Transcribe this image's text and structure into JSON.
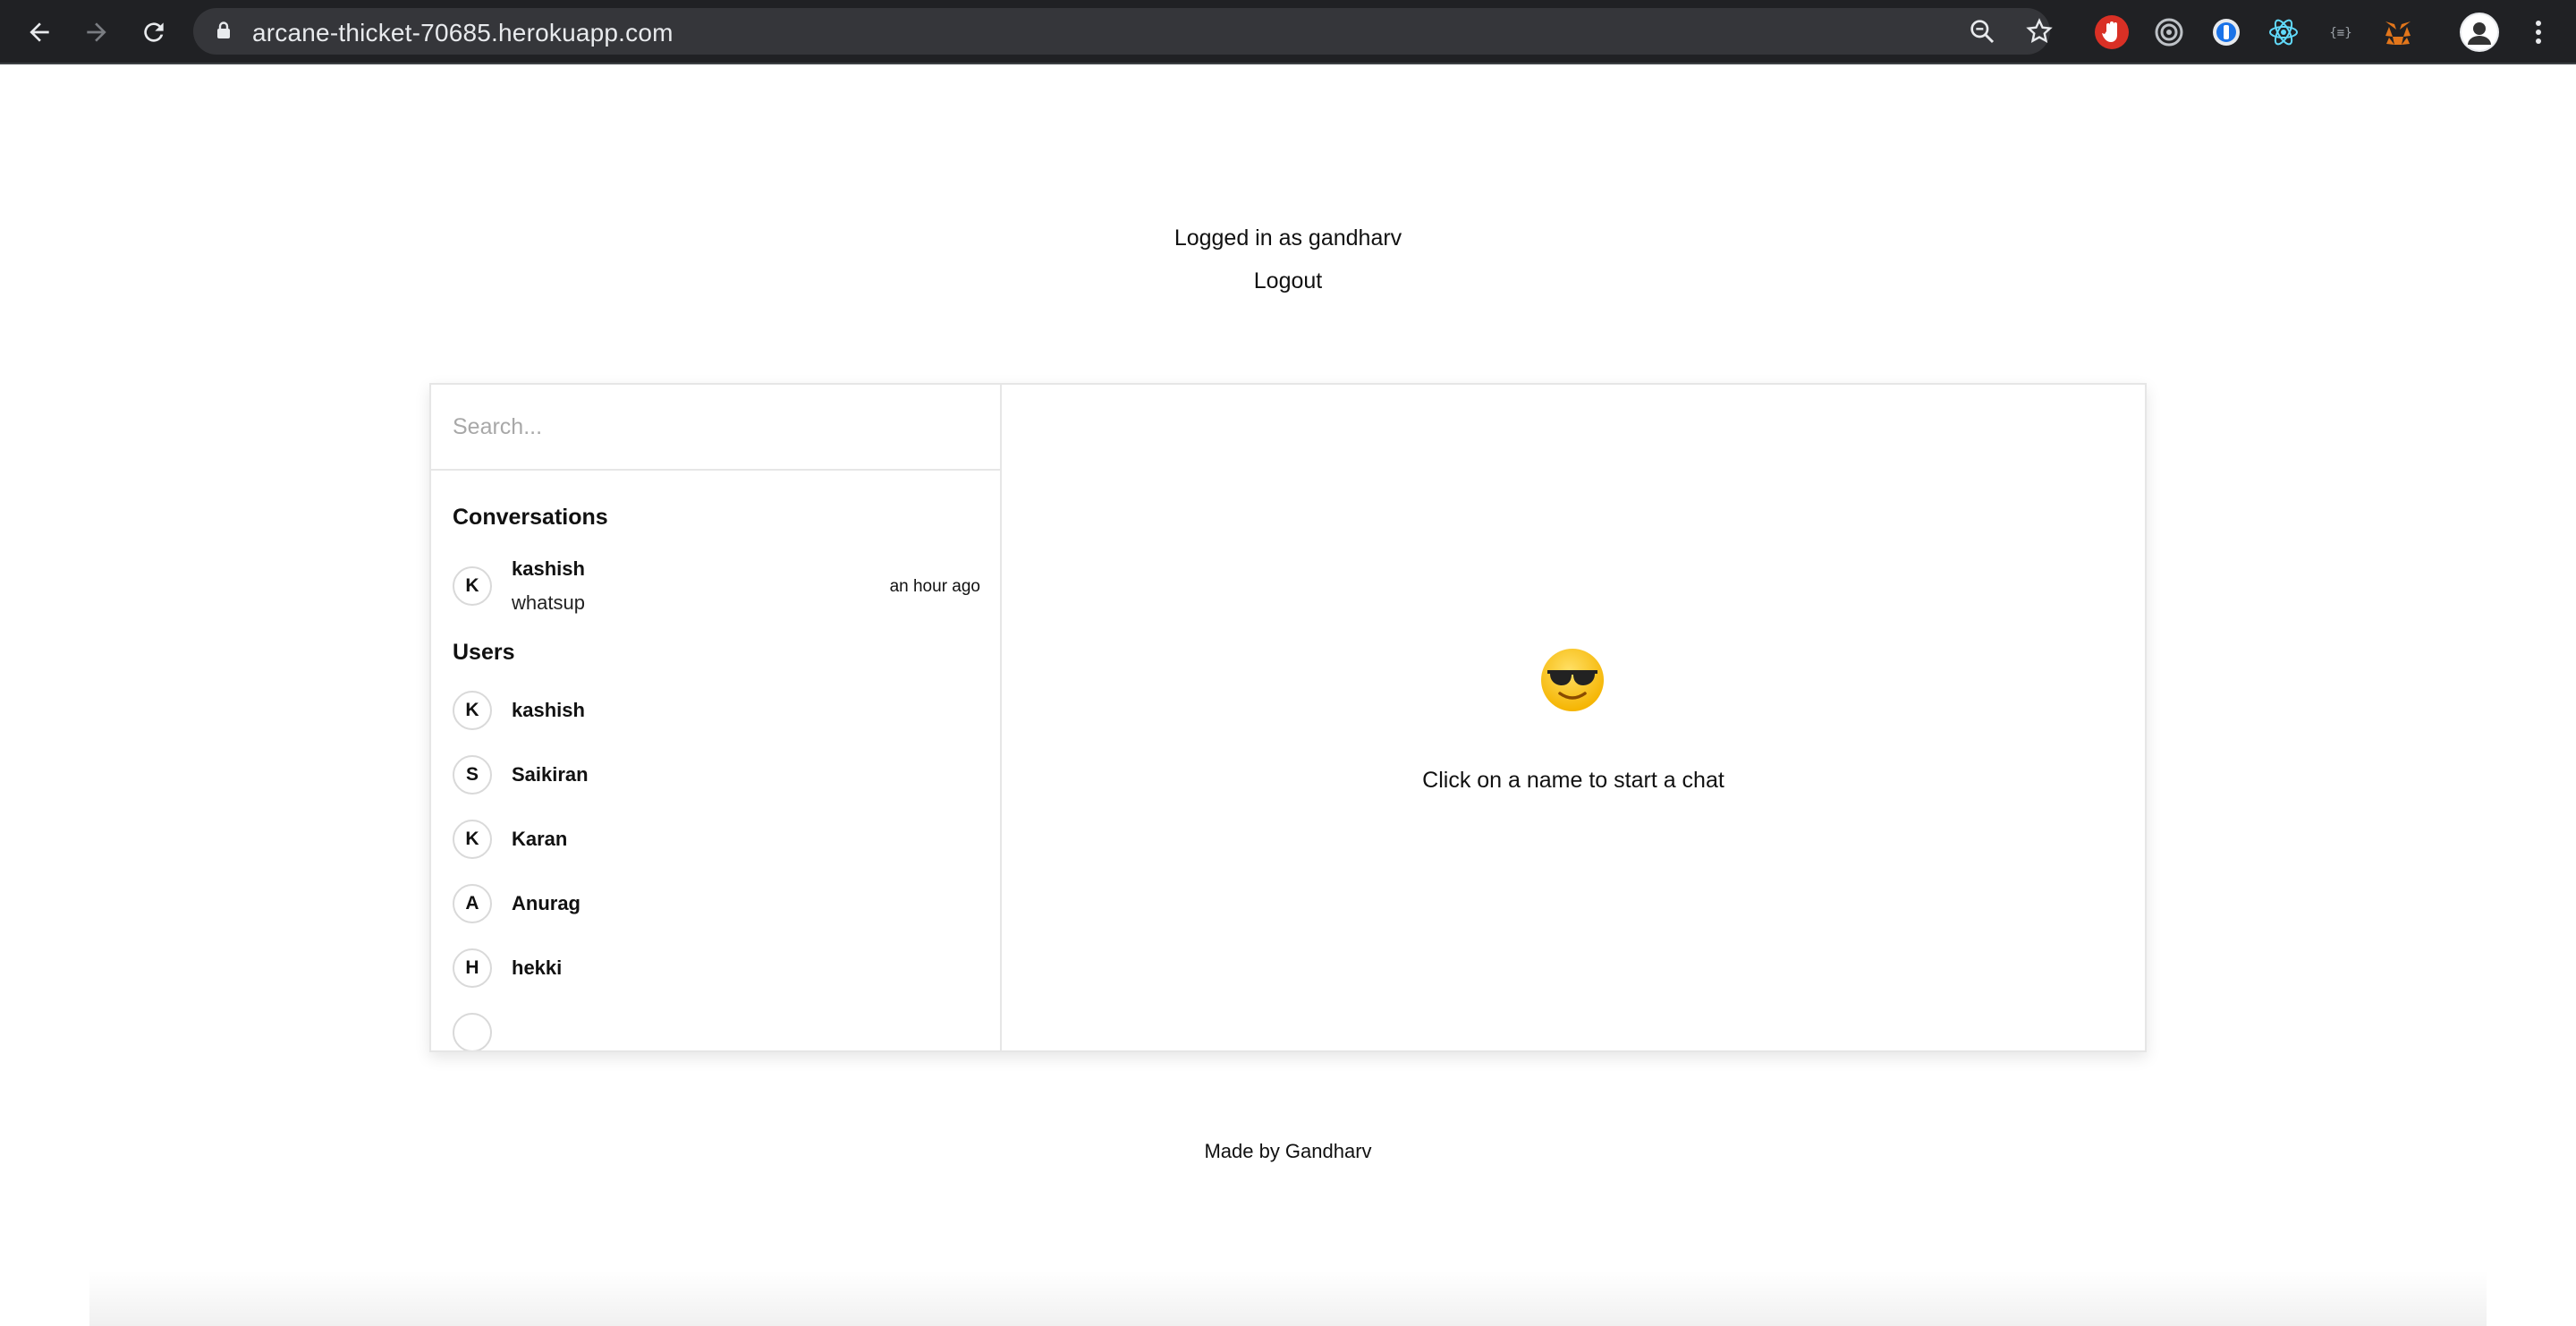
{
  "browser": {
    "url": "arcane-thicket-70685.herokuapp.com",
    "icons": [
      "back-icon",
      "forward-icon",
      "reload-icon",
      "lock-icon",
      "zoom-icon",
      "star-icon",
      "menu-icon"
    ],
    "extensions": [
      "adblock-extension-icon",
      "target-extension-icon",
      "password-extension-icon",
      "react-devtools-icon",
      "json-extension-icon",
      "metamask-icon",
      "profile-avatar"
    ]
  },
  "header": {
    "logged_in_text": "Logged in as gandharv",
    "logout_label": "Logout"
  },
  "sidebar": {
    "search_placeholder": "Search...",
    "conversations_title": "Conversations",
    "conversations": [
      {
        "initial": "K",
        "name": "kashish",
        "message": "whatsup",
        "time": "an hour ago"
      }
    ],
    "users_title": "Users",
    "users": [
      {
        "initial": "K",
        "name": "kashish"
      },
      {
        "initial": "S",
        "name": "Saikiran"
      },
      {
        "initial": "K",
        "name": "Karan"
      },
      {
        "initial": "A",
        "name": "Anurag"
      },
      {
        "initial": "H",
        "name": "hekki"
      }
    ]
  },
  "chat": {
    "emoji_icon": "sunglasses-emoji-icon",
    "hint": "Click on a name to start a chat"
  },
  "footer": {
    "text": "Made by Gandharv"
  }
}
